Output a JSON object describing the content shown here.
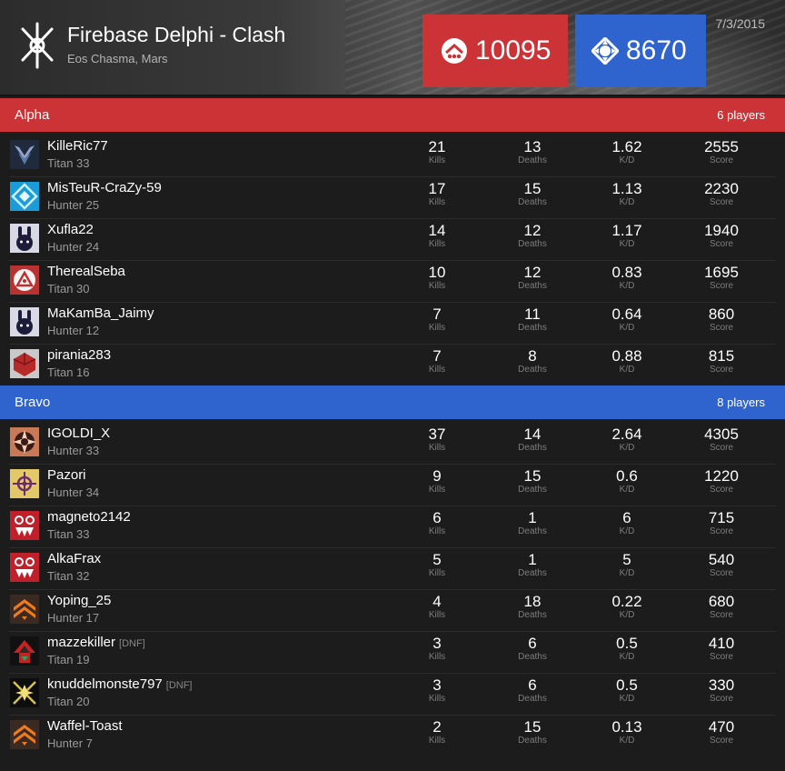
{
  "header": {
    "title": "Firebase Delphi - Clash",
    "subtitle": "Eos Chasma, Mars",
    "date": "7/3/2015",
    "alpha_score": "10095",
    "bravo_score": "8670"
  },
  "colors": {
    "alpha": "#cc3336",
    "bravo": "#2f64cf"
  },
  "stat_labels": {
    "kills": "Kills",
    "deaths": "Deaths",
    "kd": "K/D",
    "score": "Score"
  },
  "alpha": {
    "name": "Alpha",
    "count": "6 players",
    "players": [
      {
        "name": "KilleRic77",
        "cls": "Titan 33",
        "kills": "21",
        "deaths": "13",
        "kd": "1.62",
        "score": "2555",
        "dnf": "",
        "emblem": "wing-emblem"
      },
      {
        "name": "MisTeuR-CraZy-59",
        "cls": "Hunter 25",
        "kills": "17",
        "deaths": "15",
        "kd": "1.13",
        "score": "2230",
        "dnf": "",
        "emblem": "diamond-emblem"
      },
      {
        "name": "Xufla22",
        "cls": "Hunter 24",
        "kills": "14",
        "deaths": "12",
        "kd": "1.17",
        "score": "1940",
        "dnf": "",
        "emblem": "bunny-emblem"
      },
      {
        "name": "TherealSeba",
        "cls": "Titan 30",
        "kills": "10",
        "deaths": "12",
        "kd": "0.83",
        "score": "1695",
        "dnf": "",
        "emblem": "shield-emblem"
      },
      {
        "name": "MaKamBa_Jaimy",
        "cls": "Hunter 12",
        "kills": "7",
        "deaths": "11",
        "kd": "0.64",
        "score": "860",
        "dnf": "",
        "emblem": "bunny-emblem"
      },
      {
        "name": "pirania283",
        "cls": "Titan 16",
        "kills": "7",
        "deaths": "8",
        "kd": "0.88",
        "score": "815",
        "dnf": "",
        "emblem": "cube-emblem"
      }
    ]
  },
  "bravo": {
    "name": "Bravo",
    "count": "8 players",
    "players": [
      {
        "name": "IGOLDI_X",
        "cls": "Hunter 33",
        "kills": "37",
        "deaths": "14",
        "kd": "2.64",
        "score": "4305",
        "dnf": "",
        "emblem": "compass-emblem"
      },
      {
        "name": "Pazori",
        "cls": "Hunter 34",
        "kills": "9",
        "deaths": "15",
        "kd": "0.6",
        "score": "1220",
        "dnf": "",
        "emblem": "flower-emblem"
      },
      {
        "name": "magneto2142",
        "cls": "Titan 33",
        "kills": "6",
        "deaths": "1",
        "kd": "6",
        "score": "715",
        "dnf": "",
        "emblem": "fang-emblem"
      },
      {
        "name": "AlkaFrax",
        "cls": "Titan 32",
        "kills": "5",
        "deaths": "1",
        "kd": "5",
        "score": "540",
        "dnf": "",
        "emblem": "fang-emblem"
      },
      {
        "name": "Yoping_25",
        "cls": "Hunter 17",
        "kills": "4",
        "deaths": "18",
        "kd": "0.22",
        "score": "680",
        "dnf": "",
        "emblem": "chevron-emblem"
      },
      {
        "name": "mazzekiller",
        "cls": "Titan 19",
        "kills": "3",
        "deaths": "6",
        "kd": "0.5",
        "score": "410",
        "dnf": "[DNF]",
        "emblem": "arrow-emblem"
      },
      {
        "name": "knuddelmonste797",
        "cls": "Titan 20",
        "kills": "3",
        "deaths": "6",
        "kd": "0.5",
        "score": "330",
        "dnf": "[DNF]",
        "emblem": "star-emblem"
      },
      {
        "name": "Waffel-Toast",
        "cls": "Hunter 7",
        "kills": "2",
        "deaths": "15",
        "kd": "0.13",
        "score": "470",
        "dnf": "",
        "emblem": "chevron-emblem"
      }
    ]
  }
}
